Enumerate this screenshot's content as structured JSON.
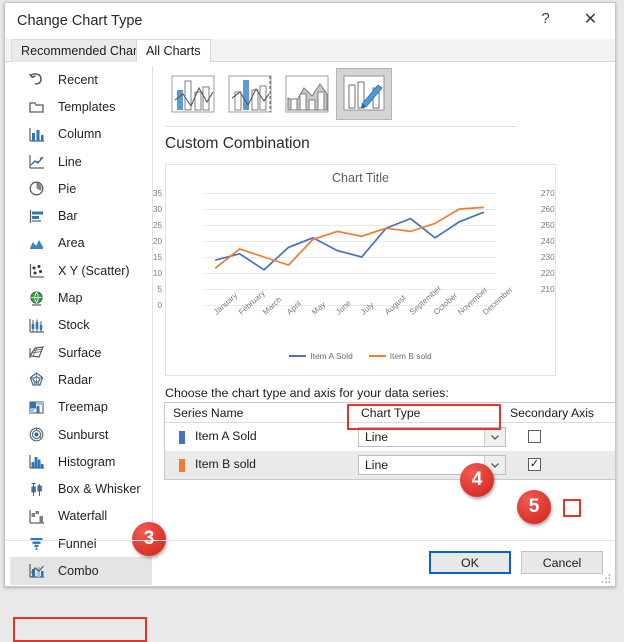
{
  "dialog": {
    "title": "Change Chart Type",
    "help_label": "?",
    "close_label": "✕"
  },
  "tabs": [
    {
      "id": "recommended",
      "label": "Recommended Charts",
      "active": false
    },
    {
      "id": "allcharts",
      "label": "All Charts",
      "active": true
    }
  ],
  "sidebar": {
    "items": [
      {
        "label": "Recent",
        "icon": "undo-arrow-icon",
        "selected": false
      },
      {
        "label": "Templates",
        "icon": "folder-icon",
        "selected": false
      },
      {
        "label": "Column",
        "icon": "column-chart-icon",
        "selected": false
      },
      {
        "label": "Line",
        "icon": "line-chart-icon",
        "selected": false
      },
      {
        "label": "Pie",
        "icon": "pie-chart-icon",
        "selected": false
      },
      {
        "label": "Bar",
        "icon": "bar-chart-icon",
        "selected": false
      },
      {
        "label": "Area",
        "icon": "area-chart-icon",
        "selected": false
      },
      {
        "label": "X Y (Scatter)",
        "icon": "scatter-chart-icon",
        "selected": false
      },
      {
        "label": "Map",
        "icon": "map-globe-icon",
        "selected": false
      },
      {
        "label": "Stock",
        "icon": "stock-chart-icon",
        "selected": false
      },
      {
        "label": "Surface",
        "icon": "surface-chart-icon",
        "selected": false
      },
      {
        "label": "Radar",
        "icon": "radar-chart-icon",
        "selected": false
      },
      {
        "label": "Treemap",
        "icon": "treemap-icon",
        "selected": false
      },
      {
        "label": "Sunburst",
        "icon": "sunburst-icon",
        "selected": false
      },
      {
        "label": "Histogram",
        "icon": "histogram-icon",
        "selected": false
      },
      {
        "label": "Box & Whisker",
        "icon": "box-whisker-icon",
        "selected": false
      },
      {
        "label": "Waterfall",
        "icon": "waterfall-icon",
        "selected": false
      },
      {
        "label": "Funnel",
        "icon": "funnel-icon",
        "selected": false
      },
      {
        "label": "Combo",
        "icon": "combo-chart-icon",
        "selected": true
      }
    ]
  },
  "type_strip": {
    "thumbs": [
      {
        "name": "clustered-column-line",
        "active": false
      },
      {
        "name": "clustered-column-line-on-secondary-axis",
        "active": false
      },
      {
        "name": "stacked-area-clustered-column",
        "active": false
      },
      {
        "name": "custom-combination",
        "active": true
      }
    ]
  },
  "combo_name": "Custom Combination",
  "series_panel": {
    "instruction": "Choose the chart type and axis for your data series:",
    "headers": {
      "series_name": "Series Name",
      "chart_type": "Chart Type",
      "secondary_axis": "Secondary Axis"
    },
    "rows": [
      {
        "series_name": "Item A Sold",
        "swatch": "#4472c4",
        "chart_type": "Line",
        "secondary_axis": false,
        "highlighted_dropdown": true
      },
      {
        "series_name": "Item B sold",
        "swatch": "#ed7d31",
        "chart_type": "Line",
        "secondary_axis": true,
        "highlighted_checkbox": true
      }
    ],
    "checkbox_check_glyph": "✓",
    "dropdown_arrow_glyph": "⌄"
  },
  "callouts": [
    {
      "number": "3",
      "target": "sidebar-item-combo"
    },
    {
      "number": "4",
      "target": "chart-type-dropdown-row-1"
    },
    {
      "number": "5",
      "target": "secondary-axis-checkbox-row-2"
    }
  ],
  "footer": {
    "ok_label": "OK",
    "cancel_label": "Cancel"
  },
  "colors": {
    "series_a": "#4472c4",
    "series_b": "#ed7d31",
    "accent_red": "#e8322a",
    "focus_blue": "#0a64c8"
  },
  "chart_data": {
    "type": "line",
    "title": "Chart Title",
    "xlabel": "",
    "ylabel": "",
    "grid": true,
    "legend_position": "bottom",
    "categories": [
      "January",
      "February",
      "March",
      "April",
      "May",
      "June",
      "July",
      "August",
      "September",
      "October",
      "November",
      "December"
    ],
    "yaxis_primary": {
      "ticks": [
        0,
        5,
        10,
        15,
        20,
        25,
        30,
        35
      ],
      "ylim": [
        0,
        35
      ]
    },
    "yaxis_secondary": {
      "ticks": [
        210,
        220,
        230,
        240,
        250,
        260,
        270
      ],
      "ylim": [
        200,
        270
      ]
    },
    "series": [
      {
        "name": "Item A Sold",
        "color": "#4472c4",
        "axis": "primary",
        "values": [
          14,
          16,
          11,
          18,
          21,
          17,
          15,
          24,
          27,
          21,
          26,
          29
        ]
      },
      {
        "name": "Item B sold",
        "color": "#ed7d31",
        "axis": "secondary",
        "values": [
          223,
          235,
          230,
          225,
          241,
          246,
          243,
          248,
          246,
          251,
          260,
          261
        ]
      }
    ]
  }
}
